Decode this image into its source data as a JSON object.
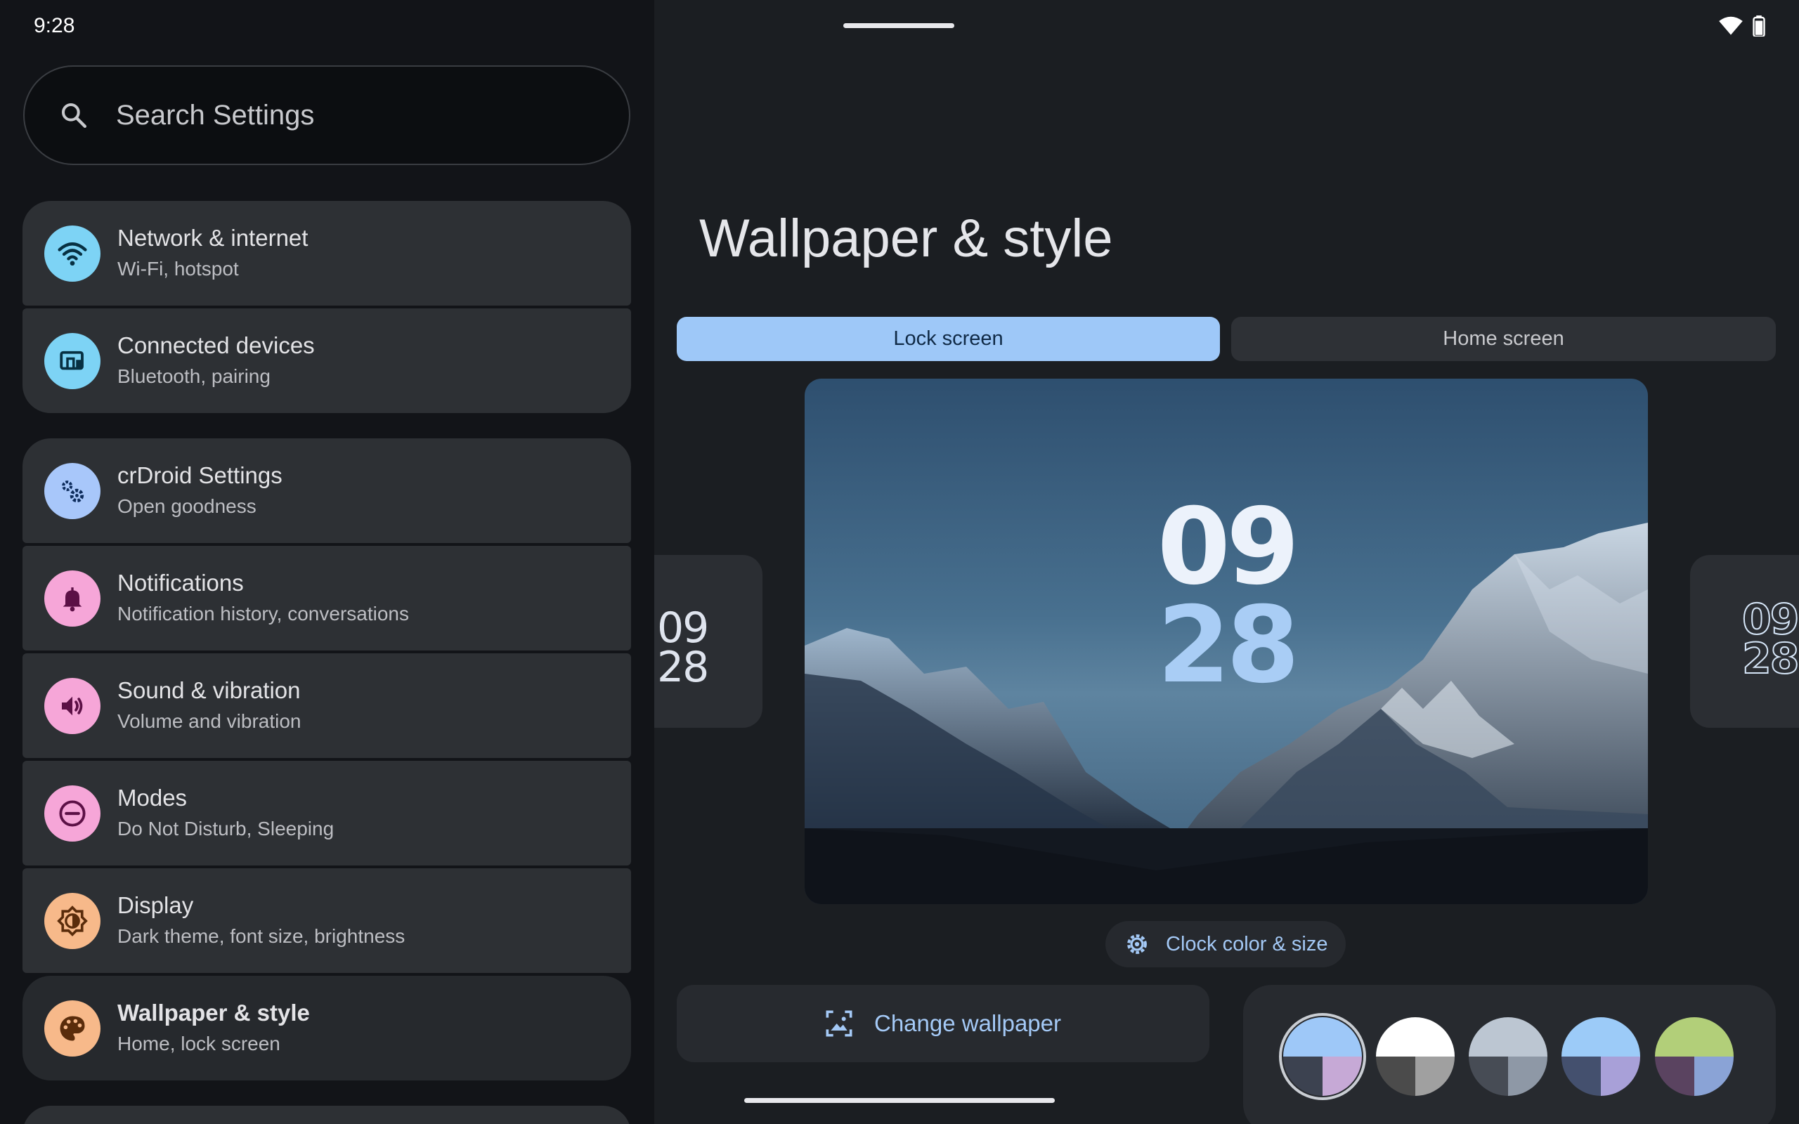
{
  "status": {
    "time": "9:28",
    "wifi_icon": "wifi-icon",
    "battery_icon": "battery-icon"
  },
  "search": {
    "placeholder": "Search Settings",
    "icon": "search-icon"
  },
  "settings_items": [
    {
      "title": "Network & internet",
      "subtitle": "Wi-Fi, hotspot",
      "icon": "wifi-icon",
      "color": "#7dd3f5"
    },
    {
      "title": "Connected devices",
      "subtitle": "Bluetooth, pairing",
      "icon": "devices-icon",
      "color": "#7dd3f5"
    },
    {
      "title": "crDroid Settings",
      "subtitle": "Open goodness",
      "icon": "gears-icon",
      "color": "#a8c7fa"
    },
    {
      "title": "Notifications",
      "subtitle": "Notification history, conversations",
      "icon": "bell-icon",
      "color": "#f6a6d8"
    },
    {
      "title": "Sound & vibration",
      "subtitle": "Volume and vibration",
      "icon": "speaker-icon",
      "color": "#f6a6d8"
    },
    {
      "title": "Modes",
      "subtitle": "Do Not Disturb, Sleeping",
      "icon": "do-not-disturb-icon",
      "color": "#f6a6d8"
    },
    {
      "title": "Display",
      "subtitle": "Dark theme, font size, brightness",
      "icon": "brightness-icon",
      "color": "#f7b98a"
    },
    {
      "title": "Wallpaper & style",
      "subtitle": "Home, lock screen",
      "icon": "palette-icon",
      "color": "#f7b98a"
    }
  ],
  "main": {
    "title": "Wallpaper & style",
    "tabs": [
      {
        "label": "Lock screen",
        "selected": true
      },
      {
        "label": "Home screen",
        "selected": false
      }
    ],
    "clock": {
      "hours": "09",
      "minutes": "28"
    },
    "clock_button": {
      "label": "Clock color & size",
      "icon": "gear-icon"
    },
    "change_wallpaper": {
      "label": "Change wallpaper",
      "icon": "wallpaper-icon"
    },
    "palettes": [
      {
        "top": "#9ec8f8",
        "bottom_left": "#3c4250",
        "bottom_right": "#c6a9d6",
        "selected": true
      },
      {
        "top": "#ffffff",
        "bottom_left": "#4b4b4b",
        "bottom_right": "#a0a0a0",
        "selected": false
      },
      {
        "top": "#bcc6d2",
        "bottom_left": "#474c55",
        "bottom_right": "#8e98a6",
        "selected": false
      },
      {
        "top": "#9ccbf8",
        "bottom_left": "#44506e",
        "bottom_right": "#a8a0d8",
        "selected": false
      },
      {
        "top": "#b2cf79",
        "bottom_left": "#5a4360",
        "bottom_right": "#8aa3d6",
        "selected": false
      }
    ]
  }
}
